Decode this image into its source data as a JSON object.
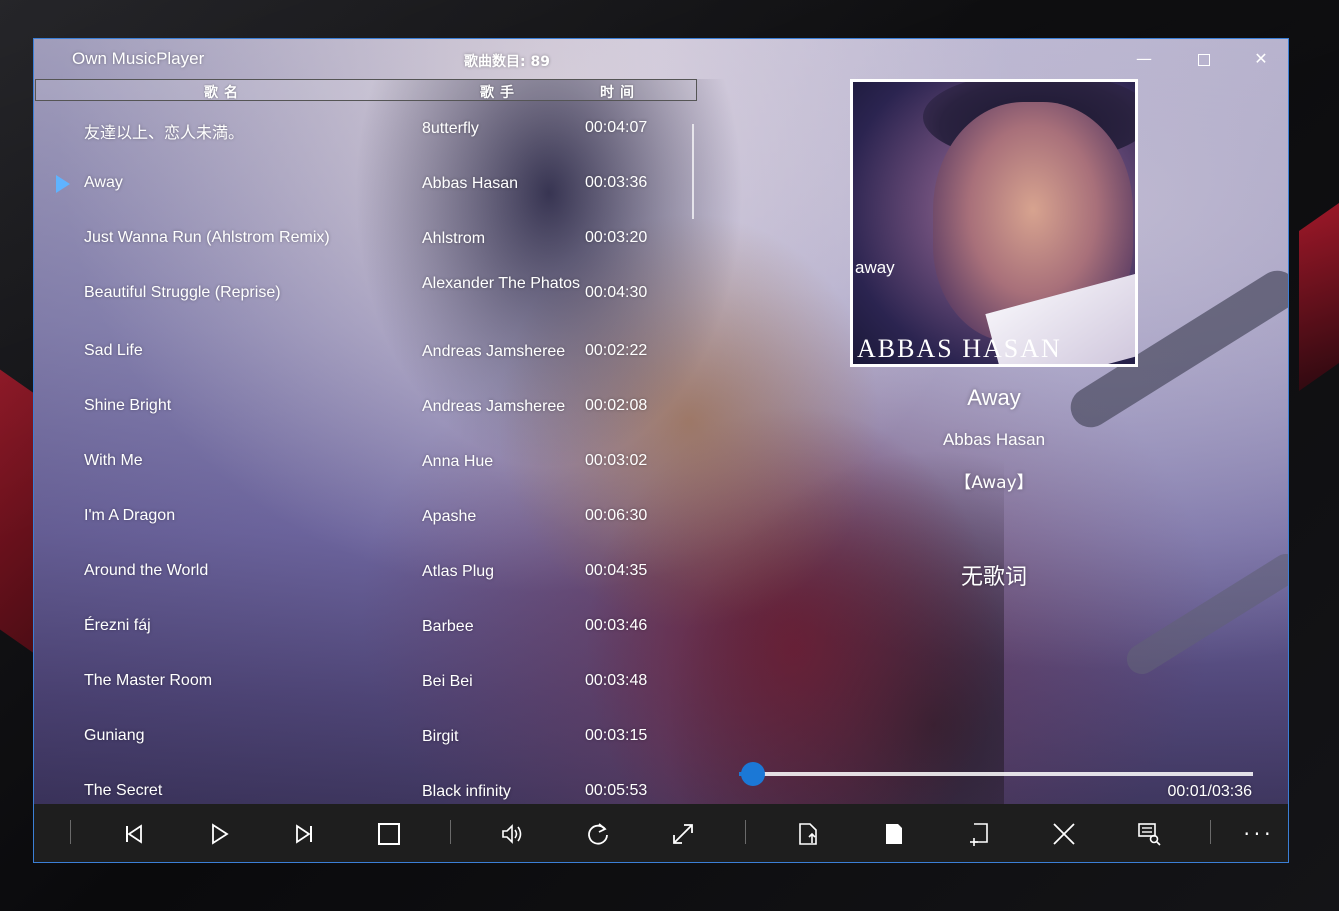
{
  "window": {
    "app_title": "Own MusicPlayer",
    "song_count": "歌曲数目: 89",
    "min_label": "—",
    "close_label": "✕"
  },
  "list": {
    "headers": {
      "name": "歌名",
      "artist": "歌手",
      "time": "时间"
    },
    "rows": [
      {
        "title": "友達以上、恋人未満。",
        "artist": "8utterfly",
        "time": "00:04:07",
        "playing": false
      },
      {
        "title": "Away",
        "artist": "Abbas Hasan",
        "time": "00:03:36",
        "playing": true
      },
      {
        "title": "Just Wanna Run (Ahlstrom Remix)",
        "artist": "Ahlstrom",
        "time": "00:03:20",
        "playing": false
      },
      {
        "title": "Beautiful Struggle (Reprise)",
        "artist": "Alexander The Phatos",
        "time": "00:04:30",
        "playing": false
      },
      {
        "title": "Sad Life",
        "artist": "Andreas Jamsheree",
        "time": "00:02:22",
        "playing": false
      },
      {
        "title": "Shine Bright",
        "artist": "Andreas Jamsheree",
        "time": "00:02:08",
        "playing": false
      },
      {
        "title": "With Me",
        "artist": "Anna Hue",
        "time": "00:03:02",
        "playing": false
      },
      {
        "title": "I'm A Dragon",
        "artist": "Apashe",
        "time": "00:06:30",
        "playing": false
      },
      {
        "title": "Around the World",
        "artist": "Atlas Plug",
        "time": "00:04:35",
        "playing": false
      },
      {
        "title": "Érezni fáj",
        "artist": "Barbee",
        "time": "00:03:46",
        "playing": false
      },
      {
        "title": "The Master Room",
        "artist": "Bei Bei",
        "time": "00:03:48",
        "playing": false
      },
      {
        "title": "Guniang",
        "artist": "Birgit",
        "time": "00:03:15",
        "playing": false
      },
      {
        "title": "The Secret",
        "artist": "Black infinity",
        "time": "00:05:53",
        "playing": false
      }
    ]
  },
  "now_playing": {
    "cover_word": "away",
    "cover_artist": "ABBAS HASAN",
    "title": "Away",
    "artist": "Abbas Hasan",
    "album": "【Away】",
    "lyrics": "无歌词",
    "time_display": "00:01/03:36",
    "progress": 0.028
  },
  "toolbar": {
    "more_label": "···",
    "icons": [
      "previous-icon",
      "play-icon",
      "next-icon",
      "stop-icon",
      "volume-icon",
      "repeat-icon",
      "fullscreen-icon",
      "open-file-icon",
      "bookmark-icon",
      "add-file-icon",
      "close-icon",
      "playlist-search-icon"
    ]
  },
  "colors": {
    "accent": "#1b78d6",
    "playing_marker": "#5fb3ff",
    "toolbar_bg": "#1e1e1e",
    "window_border": "#3b7fd6"
  }
}
